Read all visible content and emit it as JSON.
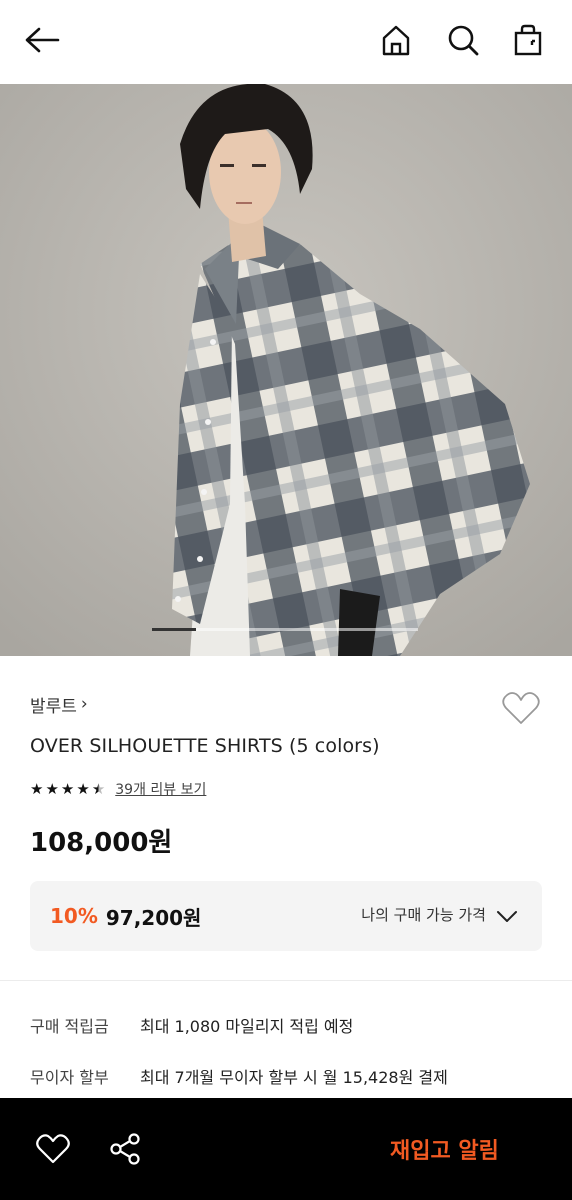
{
  "header": {
    "back_icon": "arrow-left-icon",
    "home_icon": "home-icon",
    "search_icon": "search-icon",
    "cart_icon": "shopping-bag-icon"
  },
  "hero": {
    "image_alt": "Model wearing grey plaid oversized shirt",
    "slide_indicator": "image carousel"
  },
  "product": {
    "brand": "발루트",
    "brand_chevron": "›",
    "title": "OVER SILHOUETTE SHIRTS (5 colors)",
    "rating_stars": 4.5,
    "review_link": "39개 리뷰 보기",
    "price": "108,000원"
  },
  "discount": {
    "rate": "10%",
    "price": "97,200원",
    "my_price_label": "나의 구매 가능 가격"
  },
  "info": [
    {
      "label": "구매 적립금",
      "value": "최대 1,080 마일리지 적립 예정"
    },
    {
      "label": "무이자 할부",
      "value": "최대 7개월 무이자 할부 시 월 15,428원 결제"
    }
  ],
  "bottom_bar": {
    "wish_icon": "heart-icon",
    "share_icon": "share-icon",
    "restock_label": "재입고 알림"
  },
  "colors": {
    "accent": "#f25a22",
    "bottom_bar_bg": "#000000",
    "discount_box_bg": "#f4f4f4"
  }
}
